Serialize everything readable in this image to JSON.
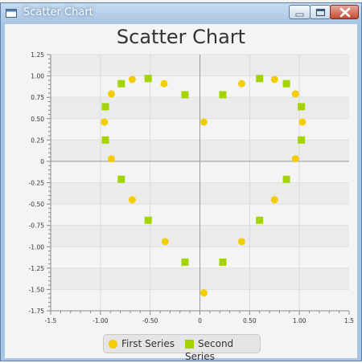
{
  "window": {
    "title": "Scatter Chart"
  },
  "legend": {
    "items": [
      "First Series",
      "Second Series"
    ]
  },
  "colors": {
    "first_series": "#f3cd00",
    "second_series": "#a2d500"
  },
  "chart_data": {
    "type": "scatter",
    "title": "Scatter Chart",
    "xlabel": "",
    "ylabel": "",
    "xlim": [
      -1.5,
      1.5
    ],
    "ylim": [
      -1.75,
      1.25
    ],
    "x_ticks": [
      "-1.5",
      "-1.00",
      "-0.50",
      "0",
      "0.50",
      "1.00",
      "1.5"
    ],
    "y_ticks": [
      "1.25",
      "1.00",
      "0.75",
      "0.50",
      "0.25",
      "0",
      "-0.25",
      "-0.50",
      "-0.75",
      "-1.00",
      "-1.25",
      "-1.50",
      "-1.75"
    ],
    "grid": true,
    "legend_position": "bottom",
    "series": [
      {
        "name": "First Series",
        "marker": "circle",
        "points": [
          [
            -0.68,
            0.96
          ],
          [
            -0.36,
            0.91
          ],
          [
            -0.89,
            0.79
          ],
          [
            -0.96,
            0.46
          ],
          [
            -0.89,
            0.03
          ],
          [
            -0.68,
            -0.45
          ],
          [
            -0.35,
            -0.94
          ],
          [
            0.04,
            -1.54
          ],
          [
            0.04,
            0.46
          ],
          [
            0.42,
            0.91
          ],
          [
            0.75,
            0.96
          ],
          [
            0.96,
            0.79
          ],
          [
            1.03,
            0.46
          ],
          [
            0.96,
            0.03
          ],
          [
            0.75,
            -0.45
          ],
          [
            0.42,
            -0.94
          ]
        ]
      },
      {
        "name": "Second Series",
        "marker": "square",
        "points": [
          [
            -0.52,
            0.97
          ],
          [
            -0.79,
            0.91
          ],
          [
            -0.95,
            0.64
          ],
          [
            -0.95,
            0.25
          ],
          [
            -0.79,
            -0.21
          ],
          [
            -0.52,
            -0.69
          ],
          [
            -0.15,
            -1.18
          ],
          [
            -0.15,
            0.78
          ],
          [
            0.23,
            0.78
          ],
          [
            0.6,
            0.97
          ],
          [
            0.87,
            0.91
          ],
          [
            1.02,
            0.64
          ],
          [
            1.02,
            0.25
          ],
          [
            0.87,
            -0.21
          ],
          [
            0.6,
            -0.69
          ],
          [
            0.23,
            -1.18
          ]
        ]
      }
    ]
  }
}
